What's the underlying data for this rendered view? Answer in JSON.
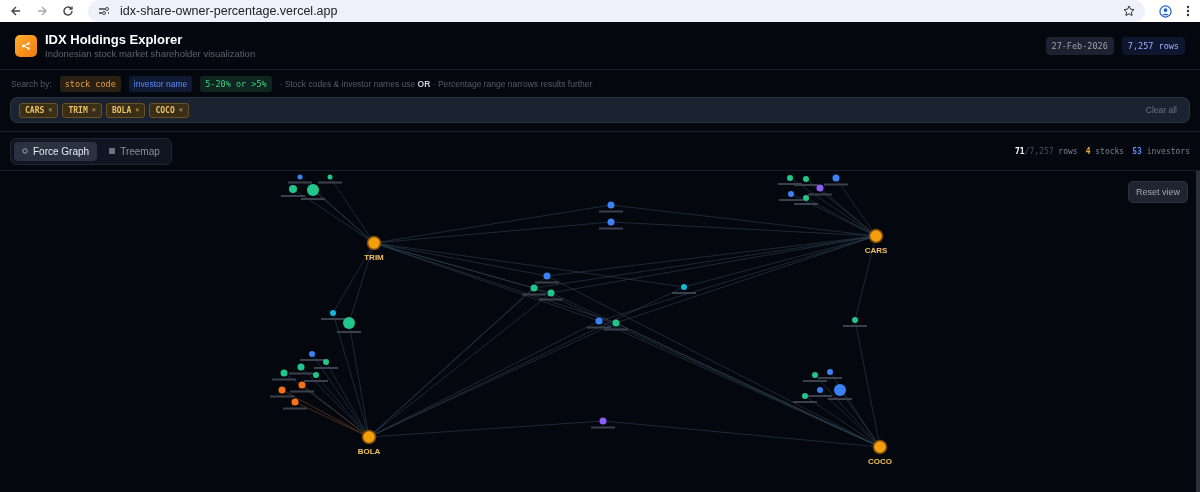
{
  "browser": {
    "url": "idx-share-owner-percentage.vercel.app"
  },
  "header": {
    "title": "IDX Holdings Explorer",
    "subtitle": "Indonesian stock market shareholder visualization",
    "date": "27-Feb-2026",
    "rows": "7,257 rows"
  },
  "search": {
    "label": "Search by:",
    "hints": [
      {
        "kind": "stock",
        "text": "stock code"
      },
      {
        "kind": "investor",
        "text": "investor name"
      },
      {
        "kind": "range",
        "text": "5-20% or >5%"
      }
    ],
    "note": "· Stock codes & investor names use **OR** · Percentage range narrows results further",
    "chips": [
      {
        "label": "CARS",
        "remove": "×"
      },
      {
        "label": "TRIM",
        "remove": "×"
      },
      {
        "label": "BOLA",
        "remove": "×"
      },
      {
        "label": "COCO",
        "remove": "×"
      }
    ],
    "clear": "Clear all"
  },
  "tabs": [
    {
      "label": "Force Graph",
      "kind": "graph",
      "selected": true
    },
    {
      "label": "Treemap",
      "kind": "treemap",
      "selected": false
    }
  ],
  "stats": {
    "shown": "71",
    "total": "/7,257",
    "rows_label": "rows",
    "stocks": "4",
    "stocks_label": "stocks",
    "investors": "53",
    "investors_label": "investors"
  },
  "graph": {
    "reset": "Reset view",
    "stocks": [
      {
        "label": "TRIM"
      },
      {
        "label": "CARS"
      },
      {
        "label": "BOLA"
      },
      {
        "label": "COCO"
      }
    ]
  }
}
